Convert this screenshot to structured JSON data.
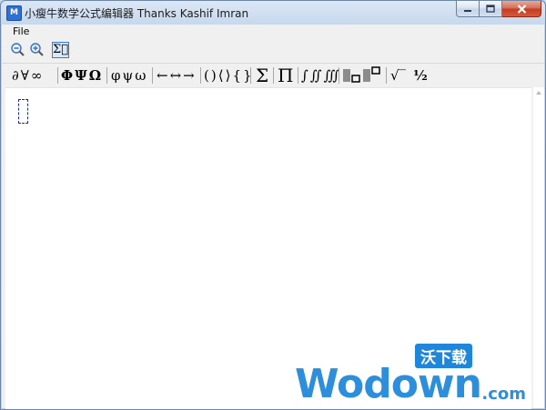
{
  "window": {
    "title": "小瘦牛数学公式编辑器 Thanks Kashif Imran",
    "app_icon_letter": "M"
  },
  "menu": {
    "file": "File"
  },
  "toolbar1": {
    "sum_label": "Σ⃞"
  },
  "toolbar2": {
    "groups": [
      [
        "∂",
        "∀",
        "∞"
      ],
      [
        "Φ",
        "Ψ",
        "Ω"
      ],
      [
        "φ",
        "ψ",
        "ω"
      ],
      [
        "←",
        "↔",
        "→"
      ],
      [
        "(",
        ")",
        "⟨",
        "⟩",
        "{",
        "}"
      ],
      [
        "Σ"
      ],
      [
        "Π"
      ],
      [
        "∫",
        "∬",
        "∭"
      ],
      [
        "√‾",
        "½"
      ]
    ]
  },
  "watermark": {
    "main": "Wodown",
    "suffix": ".com",
    "cn": "沃下载"
  },
  "colors": {
    "accent": "#3a7dd6",
    "close_red": "#c43b20",
    "watermark_blue": "#2d8fdc",
    "caret_blue": "#1a2bb0"
  }
}
